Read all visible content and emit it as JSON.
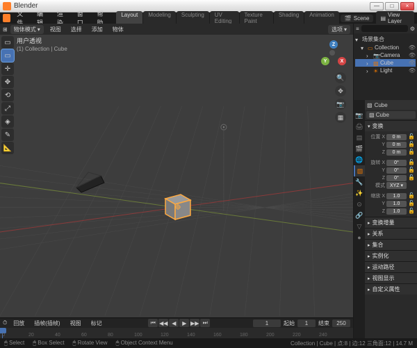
{
  "window": {
    "title": "Blender"
  },
  "winbtns": {
    "min": "—",
    "max": "□",
    "close": "×"
  },
  "menu": {
    "file": "文件",
    "edit": "编辑",
    "render": "渲染",
    "window": "窗口",
    "help": "帮助"
  },
  "workspaces": [
    "Layout",
    "Modeling",
    "Sculpting",
    "UV Editing",
    "Texture Paint",
    "Shading",
    "Animation"
  ],
  "workspace_active": 0,
  "topright": {
    "scene_label": "Scene",
    "viewlayer_label": "View Layer"
  },
  "vp_header": {
    "mode": "物体模式",
    "view": "视图",
    "select": "选择",
    "add": "添加",
    "object": "物体",
    "options": "选项"
  },
  "overlay": {
    "line1": "用户透视",
    "line2": "(1) Collection | Cube"
  },
  "tools": [
    {
      "name": "tweak",
      "glyph": "▭",
      "active": false
    },
    {
      "name": "select-box",
      "glyph": "▭",
      "active": true
    },
    {
      "name": "cursor",
      "glyph": "✛",
      "active": false
    },
    {
      "name": "move",
      "glyph": "✥",
      "active": false
    },
    {
      "name": "rotate",
      "glyph": "⟲",
      "active": false
    },
    {
      "name": "scale",
      "glyph": "⤢",
      "active": false
    },
    {
      "name": "transform",
      "glyph": "◈",
      "active": false
    },
    {
      "name": "annotate",
      "glyph": "✎",
      "active": false
    },
    {
      "name": "measure",
      "glyph": "📐",
      "active": false
    }
  ],
  "gizmo": {
    "x": "X",
    "y": "Y",
    "z": "Z"
  },
  "outliner": {
    "root": "场景集合",
    "collection": "Collection",
    "items": [
      {
        "name": "Camera",
        "icon": "📷",
        "sel": false
      },
      {
        "name": "Cube",
        "icon": "▧",
        "sel": true
      },
      {
        "name": "Light",
        "icon": "☀",
        "sel": false
      }
    ]
  },
  "props": {
    "object_name": "Cube",
    "breadcrumb": "Cube",
    "transform_label": "变换",
    "loc_label": "位置",
    "rot_label": "旋转",
    "scale_label": "缩放",
    "mode_label": "模式",
    "x": "X",
    "y": "Y",
    "z": "Z",
    "loc": {
      "x": "0 m",
      "y": "0 m",
      "z": "0 m"
    },
    "rot": {
      "x": "0°",
      "y": "0°",
      "z": "0°"
    },
    "rotmode": "XYZ",
    "scale": {
      "x": "1.0",
      "y": "1.0",
      "z": "1.0"
    },
    "sections": [
      "变换增量",
      "关系",
      "集合",
      "实例化",
      "运动路径",
      "视图显示",
      "自定义属性"
    ]
  },
  "timeline": {
    "playback": "回放",
    "keying": "插帧(插帧)",
    "view": "视图",
    "marker": "标记",
    "frame_current": "1",
    "start_label": "起始",
    "start": "1",
    "end_label": "结束",
    "end": "250",
    "ticks": [
      "0",
      "20",
      "40",
      "60",
      "80",
      "100",
      "120",
      "140",
      "160",
      "180",
      "200",
      "220",
      "240"
    ]
  },
  "status": {
    "select": "Select",
    "box": "Box Select",
    "rotate": "Rotate View",
    "context": "Object Context Menu",
    "info": "Collection | Cube | 点:8 | 边:12 三角面:12 | 14.7 M"
  }
}
